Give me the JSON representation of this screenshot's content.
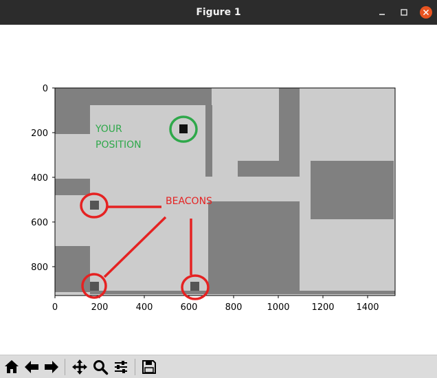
{
  "window": {
    "title": "Figure 1"
  },
  "plot": {
    "x_ticks": [
      "0",
      "200",
      "400",
      "600",
      "800",
      "1000",
      "1200",
      "1400"
    ],
    "y_ticks": [
      "0",
      "200",
      "400",
      "600",
      "800"
    ],
    "xlim": [
      0,
      1520
    ],
    "ylim": [
      930,
      0
    ],
    "grid": false,
    "colors": {
      "wall": "#808080",
      "floor": "#cccccc",
      "position_marker": "#111111",
      "beacon_marker": "#555555",
      "position_annotation": "#2ea84a",
      "beacon_annotation": "#e52222"
    },
    "position_label_line1": "YOUR",
    "position_label_line2": "POSITION",
    "beacons_label": "BEACONS",
    "position": {
      "x": 575,
      "y": 185
    },
    "beacons": [
      {
        "x": 175,
        "y": 530
      },
      {
        "x": 175,
        "y": 885
      },
      {
        "x": 625,
        "y": 885
      }
    ]
  },
  "toolbar": {
    "icons": [
      "home-icon",
      "back-arrow-icon",
      "forward-arrow-icon",
      "pan-icon",
      "zoom-icon",
      "configure-subplots-icon",
      "save-icon"
    ]
  }
}
